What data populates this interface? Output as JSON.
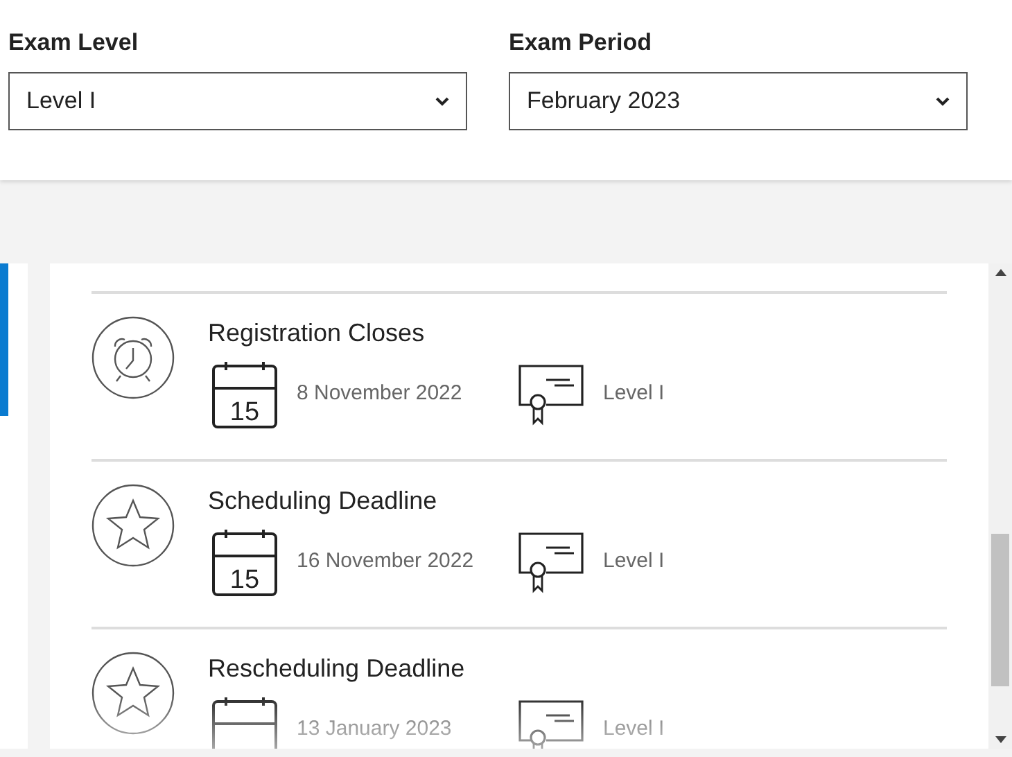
{
  "filters": [
    {
      "label": "Exam Level",
      "value": "Level I"
    },
    {
      "label": "Exam Period",
      "value": "February 2023"
    }
  ],
  "events": [
    {
      "kind": "alarm",
      "title": "Registration Closes",
      "calendar_day": "15",
      "date": "8 November 2022",
      "level": "Level I"
    },
    {
      "kind": "star",
      "title": "Scheduling Deadline",
      "calendar_day": "15",
      "date": "16 November 2022",
      "level": "Level I"
    },
    {
      "kind": "star",
      "title": "Rescheduling Deadline",
      "date": "13 January 2023",
      "level": "Level I"
    }
  ]
}
